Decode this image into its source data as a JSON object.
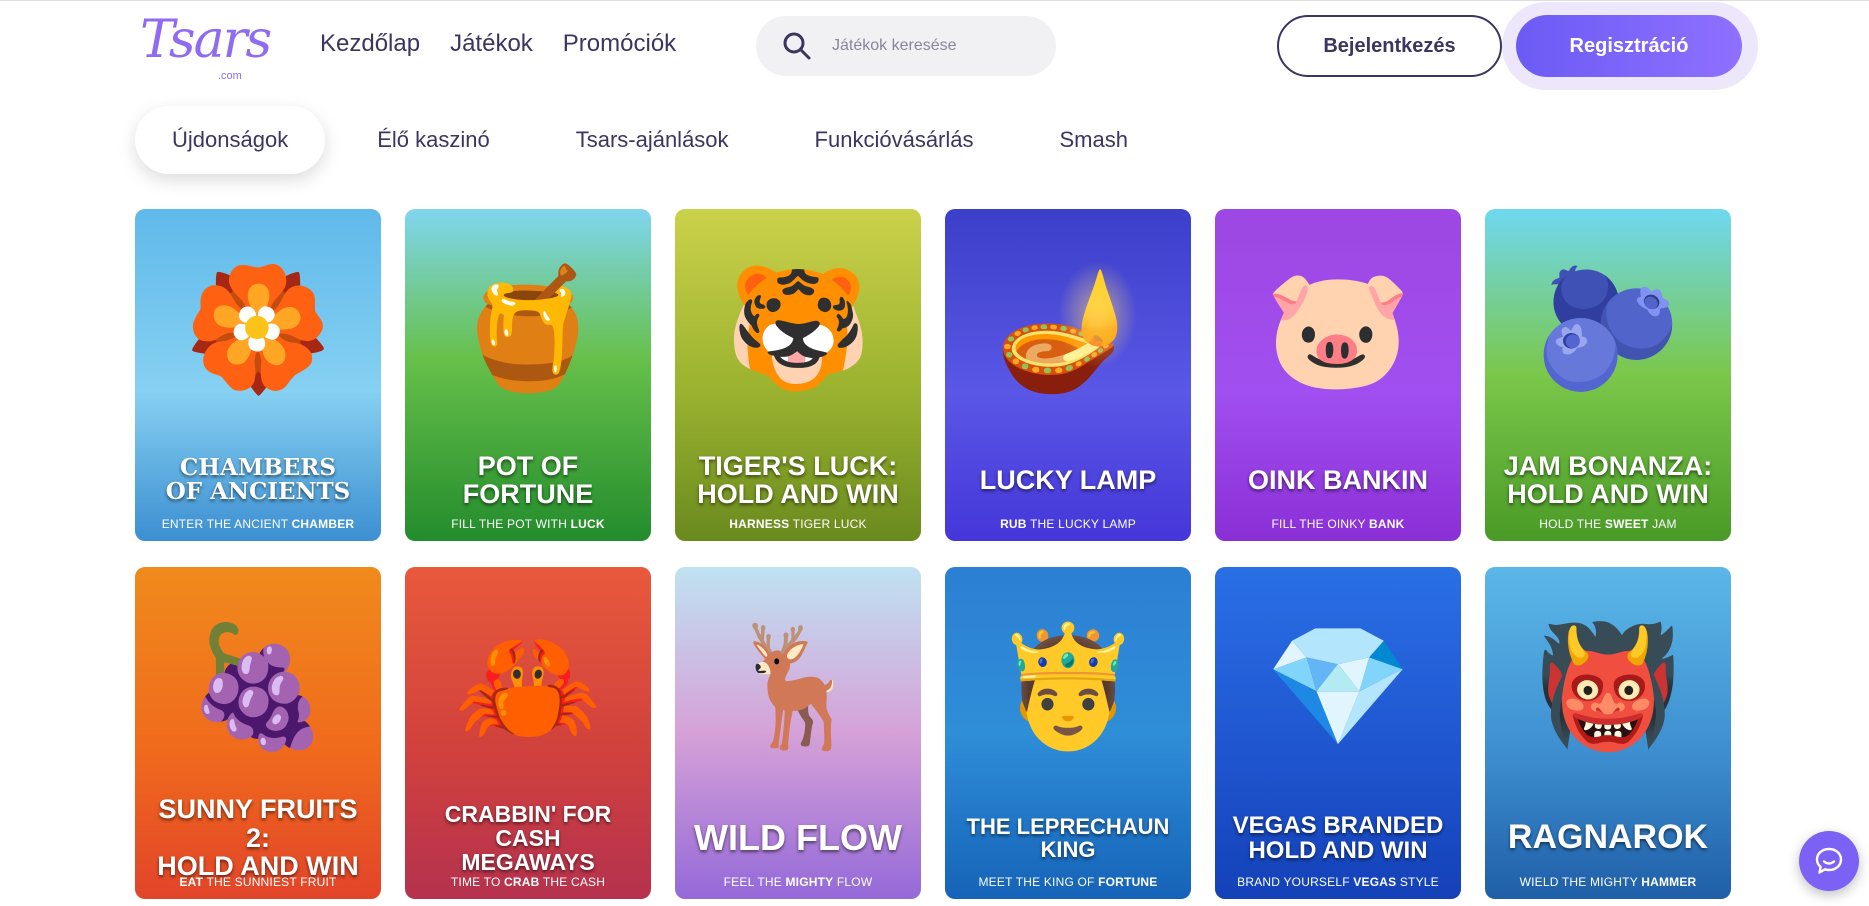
{
  "header": {
    "logo_text": "Tsars",
    "logo_sub": ".com",
    "nav": [
      "Kezdőlap",
      "Játékok",
      "Promóciók"
    ],
    "search_placeholder": "Játékok keresése",
    "login_label": "Bejelentkezés",
    "register_label": "Regisztráció"
  },
  "tabs": [
    "Újdonságok",
    "Élő kaszinó",
    "Tsars-ajánlások",
    "Funkcióvásárlás",
    "Smash"
  ],
  "games": [
    {
      "title": "Chambers\nof Ancients",
      "tag_pre": "Enter the ancient ",
      "tag_bold": "Chamber",
      "tag_post": "",
      "icon": "compass-medallion-icon"
    },
    {
      "title": "Pot of Fortune",
      "tag_pre": "Fill the pot with ",
      "tag_bold": "Luck",
      "tag_post": "",
      "icon": "gold-pot-icon"
    },
    {
      "title": "Tiger's Luck:\nHold and Win",
      "tag_pre": "",
      "tag_bold": "Harness",
      "tag_post": " tiger luck",
      "icon": "tiger-icon"
    },
    {
      "title": "Lucky Lamp",
      "tag_pre": "",
      "tag_bold": "Rub",
      "tag_post": " the lucky lamp",
      "icon": "magic-lamp-icon"
    },
    {
      "title": "Oink Bankin",
      "tag_pre": "Fill the oinky ",
      "tag_bold": "Bank",
      "tag_post": "",
      "icon": "piggy-bank-icon"
    },
    {
      "title": "Jam Bonanza:\nHold and Win",
      "tag_pre": "Hold the ",
      "tag_bold": "Sweet",
      "tag_post": " jam",
      "icon": "jam-jar-icon"
    },
    {
      "title": "Sunny Fruits 2:\nHold and Win",
      "tag_pre": "",
      "tag_bold": "Eat",
      "tag_post": " the sunniest fruit",
      "icon": "sun-grapes-icon"
    },
    {
      "title": "Crabbin' for Cash\nMegaways",
      "tag_pre": "Time to ",
      "tag_bold": "Crab",
      "tag_post": " the cash",
      "icon": "crab-icon"
    },
    {
      "title": "Wild Flow",
      "tag_pre": "Feel the ",
      "tag_bold": "Mighty",
      "tag_post": " flow",
      "icon": "elk-icon"
    },
    {
      "title": "The Leprechaun King",
      "tag_pre": "Meet the king of ",
      "tag_bold": "Fortune",
      "tag_post": "",
      "icon": "leprechaun-icon"
    },
    {
      "title": "Vegas Branded\nHold and Win",
      "tag_pre": "Brand yourself ",
      "tag_bold": "Vegas",
      "tag_post": " style",
      "icon": "diamond-dice-icon"
    },
    {
      "title": "Ragnarok",
      "tag_pre": "Wield the mighty ",
      "tag_bold": "Hammer",
      "tag_post": "",
      "icon": "viking-god-icon"
    }
  ],
  "art": [
    "🏵️",
    "🍯",
    "🐯",
    "🪔",
    "🐷",
    "🫐",
    "🍇",
    "🦀",
    "🦌",
    "🤴",
    "💎",
    "👹"
  ],
  "colors": {
    "accent": "#7b62f5",
    "text": "#3d3560"
  }
}
